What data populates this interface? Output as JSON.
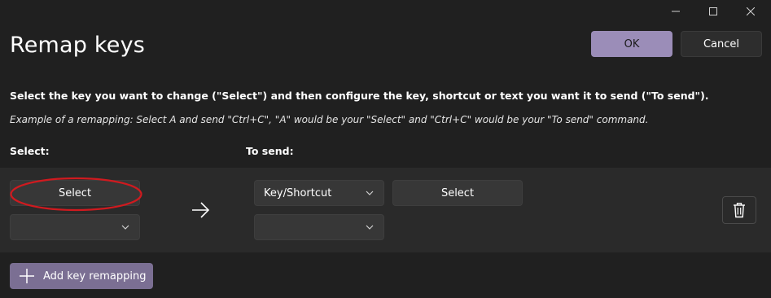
{
  "window": {
    "title": "Remap keys",
    "controls": {
      "minimize": "minimize-icon",
      "maximize": "maximize-icon",
      "close": "close-icon"
    }
  },
  "header": {
    "ok_label": "OK",
    "cancel_label": "Cancel"
  },
  "instructions": {
    "main": "Select the key you want to change (\"Select\") and then configure the key, shortcut or text you want it to send (\"To send\").",
    "example": "Example of a remapping: Select A and send \"Ctrl+C\", \"A\" would be your \"Select\" and \"Ctrl+C\" would be your \"To send\" command."
  },
  "columns": {
    "select": "Select:",
    "to_send": "To send:"
  },
  "mapping_row": {
    "select_button_label": "Select",
    "select_key_value": "",
    "arrow_icon": "arrow-right-icon",
    "send_type_value": "Key/Shortcut",
    "send_select_button_label": "Select",
    "send_key_value": "",
    "delete_icon": "trash-icon"
  },
  "footer": {
    "add_label": "Add key remapping",
    "add_icon": "plus-icon"
  },
  "colors": {
    "background": "#202020",
    "row_band": "#2a2a2a",
    "accent": "#9b8db8",
    "add_button": "#7b6f93",
    "highlight_ring": "#d01a1f"
  }
}
